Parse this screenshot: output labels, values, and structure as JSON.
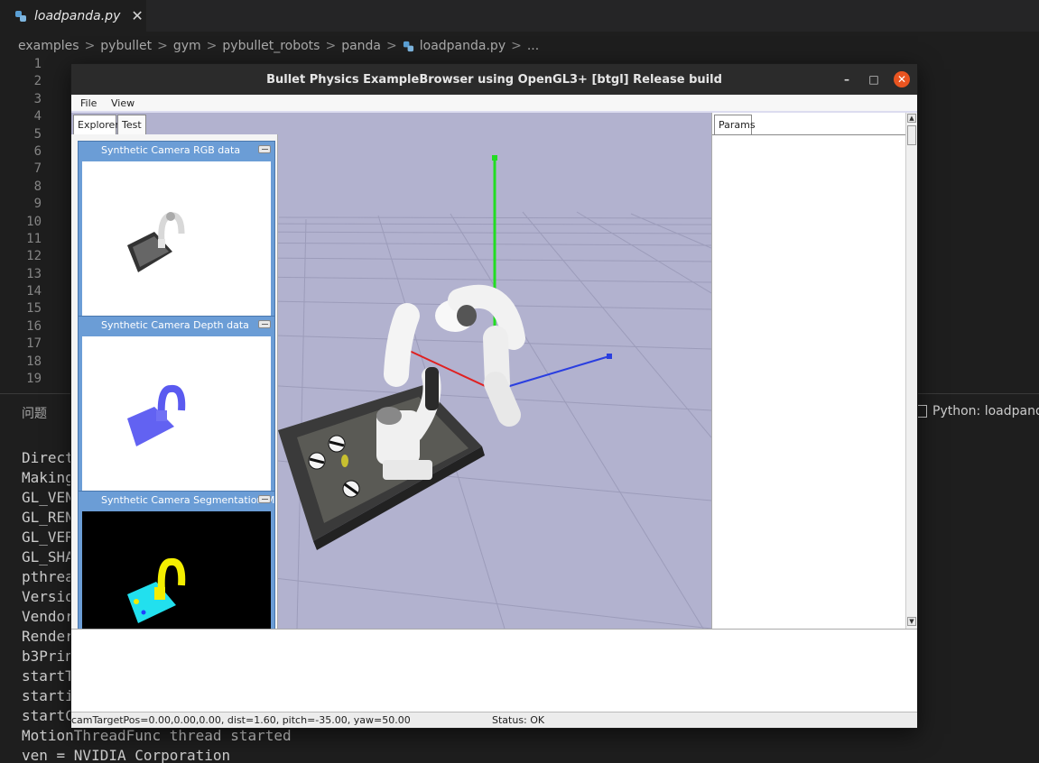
{
  "editor": {
    "tab_label": "loadpanda.py",
    "tab_close": "✕",
    "breadcrumb": [
      "examples",
      "pybullet",
      "gym",
      "pybullet_robots",
      "panda",
      "loadpanda.py",
      "..."
    ],
    "breadcrumb_sep": ">",
    "line_numbers": [
      "1",
      "2",
      "3",
      "4",
      "5",
      "6",
      "7",
      "8",
      "9",
      "10",
      "11",
      "12",
      "13",
      "14",
      "15",
      "16",
      "17",
      "18",
      "19"
    ],
    "panel_tab": "问题",
    "terminal_selector": "Python: loadpanda",
    "terminal_lines": [
      "Direct",
      "Making",
      "GL_VEN",
      "GL_REN",
      "GL_VER",
      "GL_SHA",
      "pthrea",
      "Versio",
      "Vendor",
      "Render",
      "b3Prin",
      "startT",
      "starti",
      "startC",
      "MotionThreadFunc thread started",
      "ven = NVIDIA Corporation"
    ]
  },
  "bullet": {
    "title": "Bullet Physics ExampleBrowser using OpenGL3+ [btgl] Release build",
    "window_controls": {
      "minimize": "–",
      "maximize": "□",
      "close": "✕"
    },
    "menu": {
      "file": "File",
      "view": "View"
    },
    "explorer_tabs": {
      "explorer": "Explorer",
      "test": "Test"
    },
    "params_tab": "Params",
    "cameras": [
      {
        "title": "Synthetic Camera RGB data"
      },
      {
        "title": "Synthetic Camera Depth data"
      },
      {
        "title": "Synthetic Camera Segmentation Mask"
      }
    ],
    "status": {
      "cam": "camTargetPos=0.00,0.00,0.00, dist=1.60, pitch=-35.00, yaw=50.00",
      "status": "Status: OK"
    },
    "colors": {
      "viewport_bg": "#b2b2cf",
      "axis_y": "#22dd22",
      "axis_z": "#2a3ee0",
      "axis_x": "#e02020",
      "segment_tray": "#22e0ee",
      "segment_robot": "#f4ee00",
      "depth_blue": "#6262f2",
      "panel_title_bg": "#6b9dd6"
    }
  }
}
